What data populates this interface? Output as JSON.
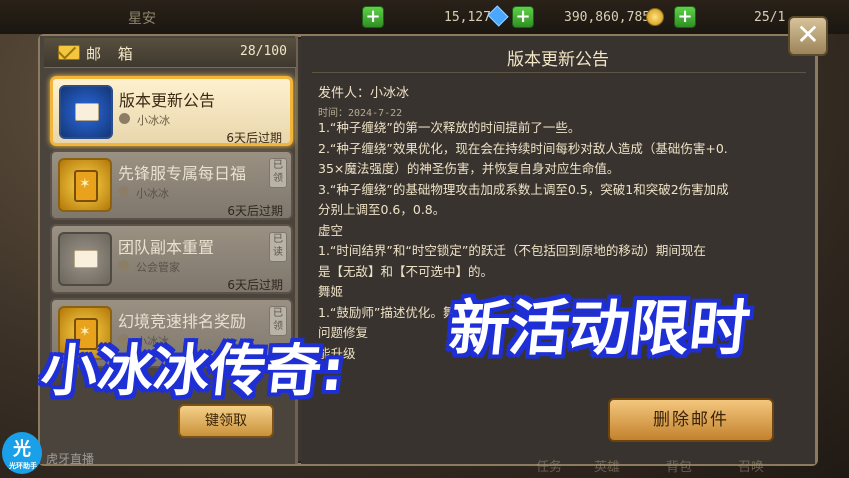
{
  "hud": {
    "player_name": "星安",
    "gems": "15,127",
    "gold": "390,860,785",
    "stamina": "25/1"
  },
  "mailbox": {
    "title": "邮 箱",
    "count": "28/100",
    "items": [
      {
        "title": "版本更新公告",
        "sender": "小冰冰",
        "expire": "6天后过期",
        "read_tag": "",
        "selected": true
      },
      {
        "title": "先锋服专属每日福",
        "sender": "小冰冰",
        "expire": "6天后过期",
        "read_tag": "已领"
      },
      {
        "title": "团队副本重置",
        "sender": "公会管家",
        "expire": "6天后过期",
        "read_tag": "已读"
      },
      {
        "title": "幻境竞速排名奖励",
        "sender": "小冰冰",
        "expire": "",
        "read_tag": "已领"
      }
    ],
    "claim_all_label": "键领取"
  },
  "detail": {
    "title": "版本更新公告",
    "sender_line": "发件人：小冰冰",
    "time_line": "时间：2024-7-22",
    "body": [
      "1.“种子缠绕”的第一次释放的时间提前了一些。",
      "2.“种子缠绕”效果优化，现在会在持续时间每秒对敌人造成（基础伤害+0.",
      "35×魔法强度）的神圣伤害，并恢复自身对应生命值。",
      "3.“种子缠绕”的基础物理攻击加成系数上调至0.5，突破1和突破2伤害加成",
      "分别上调至0.6，0.8。",
      "虚空",
      "1.“时间结界”和“时空锁定”的跃迁（不包括回到原地的移动）期间现在",
      "是【无敌】和【不可选中】的。",
      "舞姬",
      "1.“鼓励师”描述优化。舞姬在",
      "问题修复",
      "能升级"
    ],
    "delete_label": "删除邮件"
  },
  "close_label": "✕",
  "bottom_tabs": [
    "任务",
    "英雄",
    "背包",
    "召唤"
  ],
  "overlay": {
    "left_text": "小冰冰传奇:",
    "right_text": "新活动限时"
  },
  "logo": {
    "glyph": "光",
    "caption": "光环助手"
  },
  "watermark": "虎牙直播"
}
